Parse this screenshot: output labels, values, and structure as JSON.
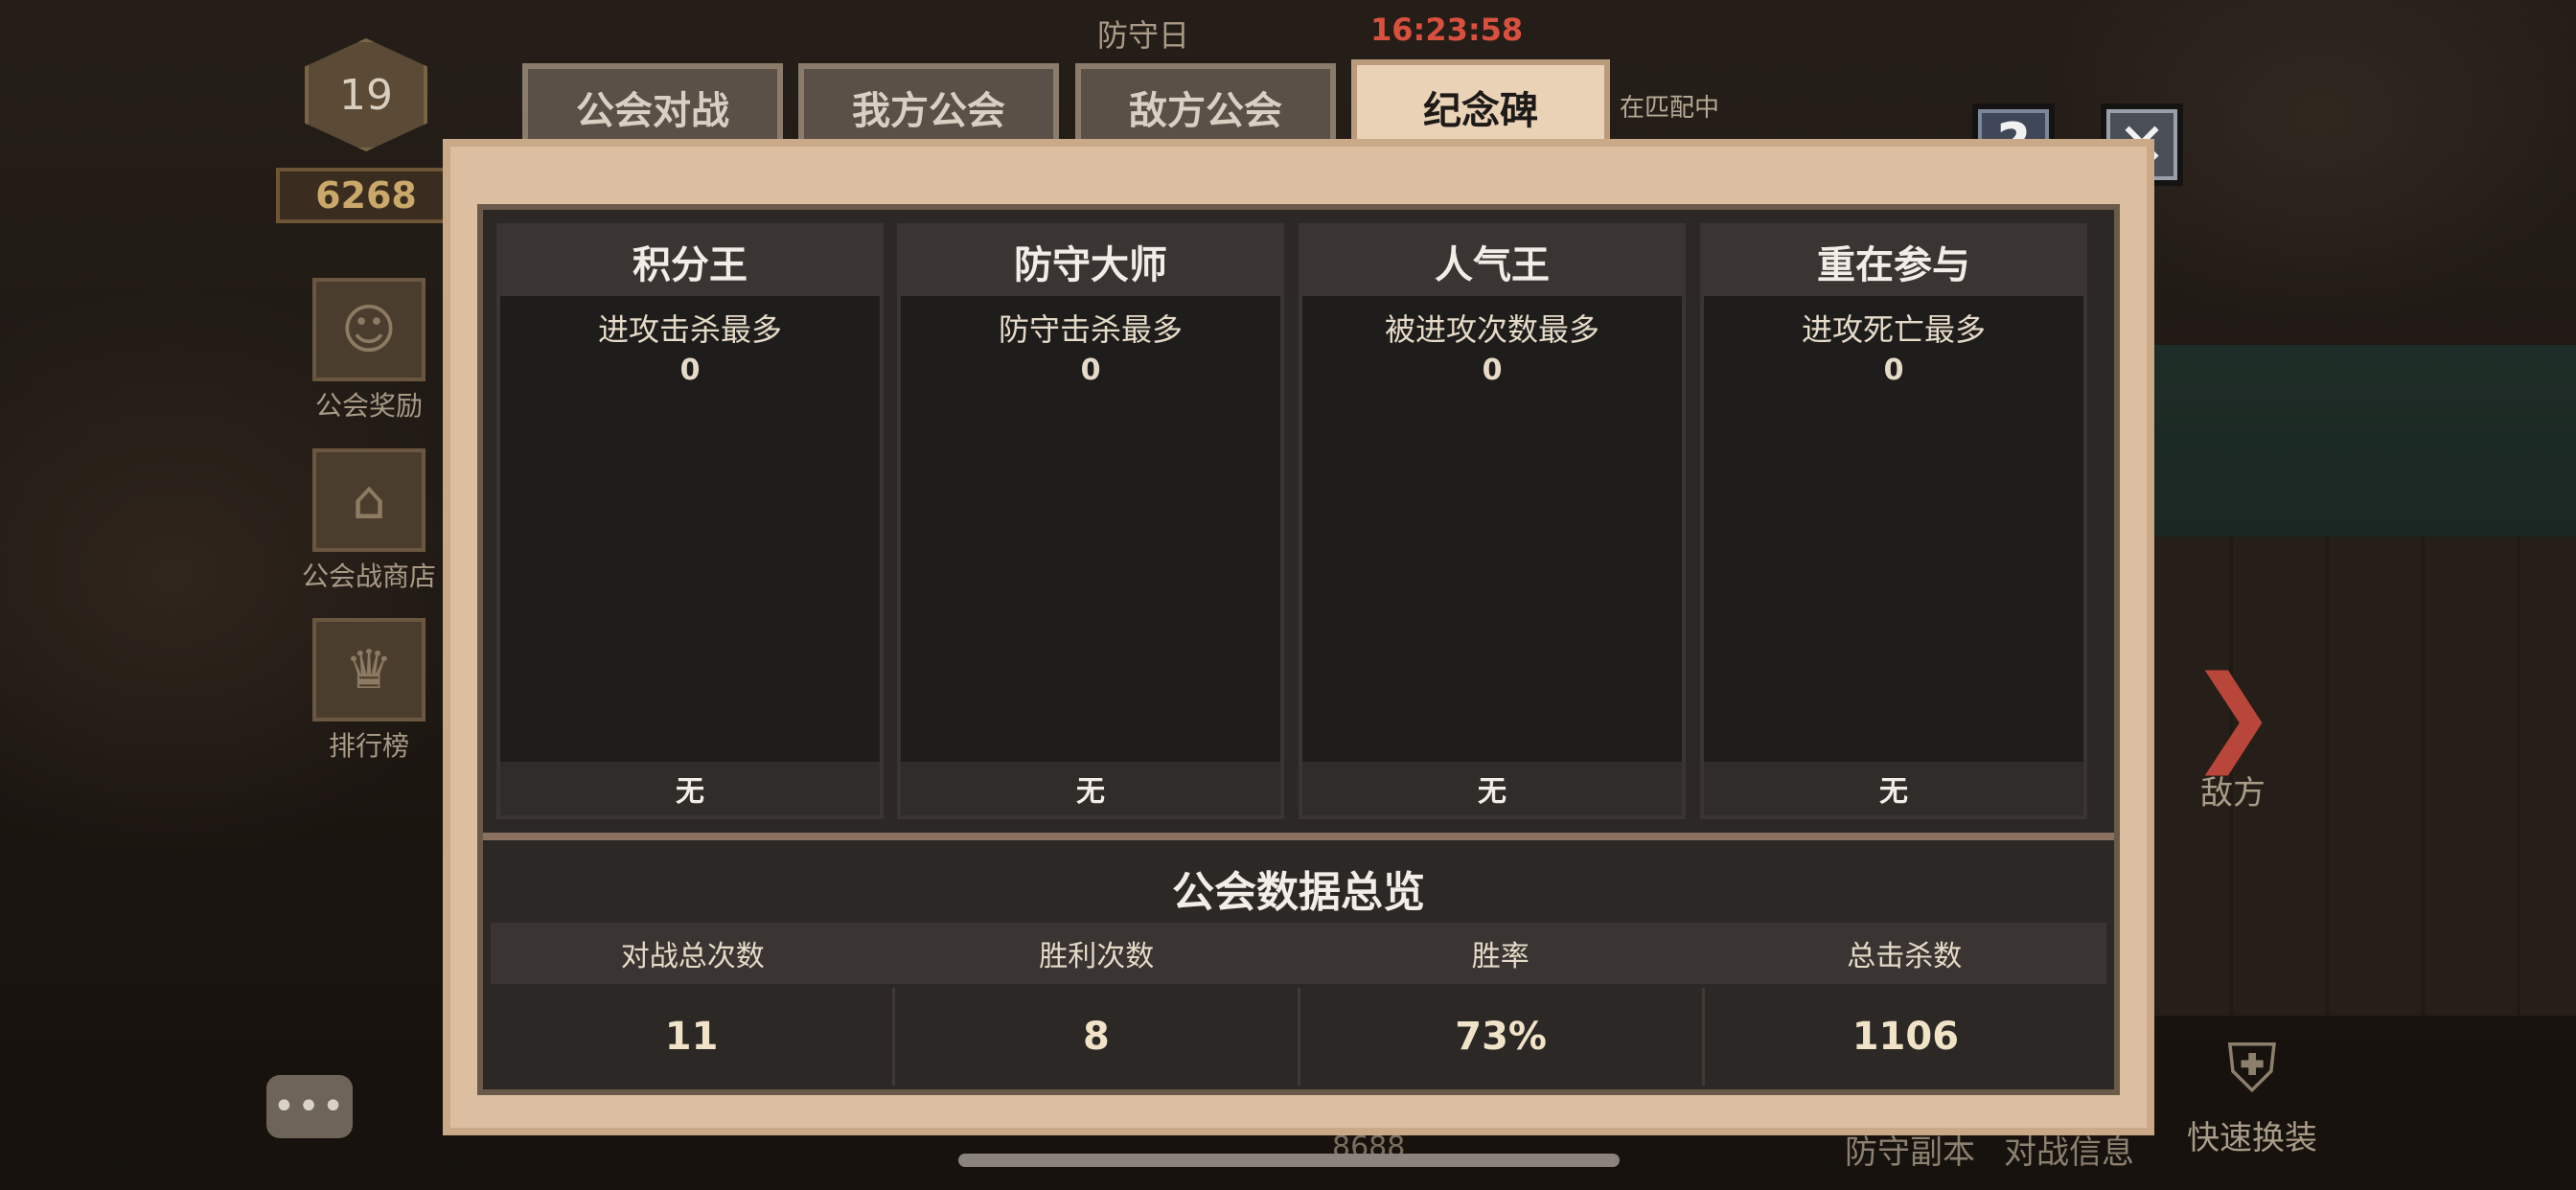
{
  "top": {
    "phase": "防守日",
    "timer": "16:23:58",
    "matching": "在匹配中"
  },
  "sidebar": {
    "level": "19",
    "power": "6268",
    "buttons": [
      {
        "label": "公会奖励",
        "icon": "reward-icon"
      },
      {
        "label": "公会战商店",
        "icon": "shop-icon"
      },
      {
        "label": "排行榜",
        "icon": "trophy-icon"
      }
    ]
  },
  "tabs": [
    {
      "label": "公会对战",
      "active": false
    },
    {
      "label": "我方公会",
      "active": false
    },
    {
      "label": "敌方公会",
      "active": false
    },
    {
      "label": "纪念碑",
      "active": true
    }
  ],
  "awards": [
    {
      "title": "积分王",
      "desc": "进攻击杀最多",
      "value": "0",
      "holder": "无"
    },
    {
      "title": "防守大师",
      "desc": "防守击杀最多",
      "value": "0",
      "holder": "无"
    },
    {
      "title": "人气王",
      "desc": "被进攻次数最多",
      "value": "0",
      "holder": "无"
    },
    {
      "title": "重在参与",
      "desc": "进攻死亡最多",
      "value": "0",
      "holder": "无"
    }
  ],
  "summary": {
    "title": "公会数据总览",
    "headers": [
      "对战总次数",
      "胜利次数",
      "胜率",
      "总击杀数"
    ],
    "values": [
      "11",
      "8",
      "73%",
      "1106"
    ]
  },
  "right": {
    "enemy_label": "敌方",
    "bottom_labels": [
      "防守副本",
      "对战信息"
    ],
    "quick_swap": "快速换装",
    "bottom_power": "8688"
  },
  "buttons": {
    "help": "?",
    "close": "✕"
  }
}
